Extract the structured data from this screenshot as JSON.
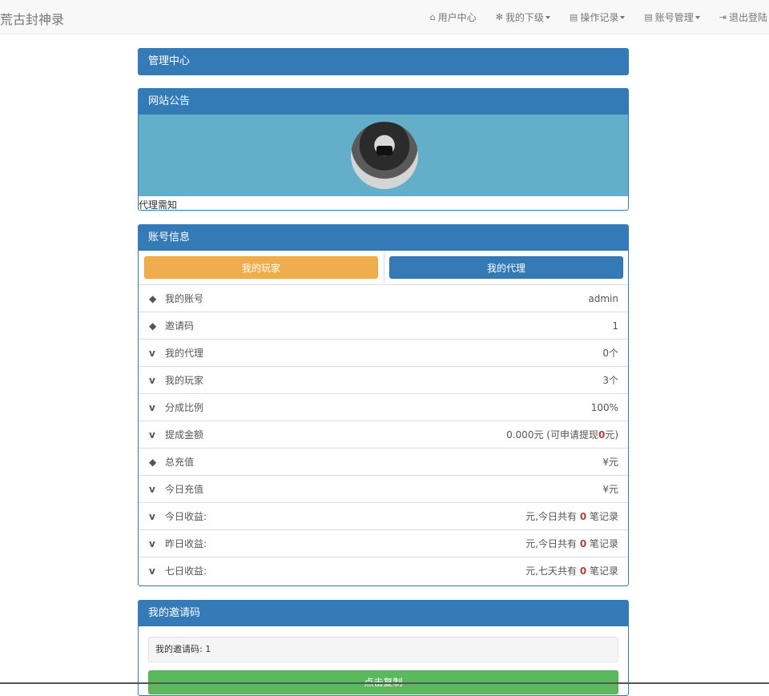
{
  "navbar": {
    "brand": "荒古封神录",
    "items": [
      {
        "icon": "home-icon",
        "glyph": "⌂",
        "label": "用户中心",
        "dropdown": false
      },
      {
        "icon": "gear-icon",
        "glyph": "✻",
        "label": "我的下级",
        "dropdown": true
      },
      {
        "icon": "id-card-icon",
        "glyph": "▤",
        "label": "操作记录",
        "dropdown": true
      },
      {
        "icon": "id-card-icon",
        "glyph": "▤",
        "label": "账号管理",
        "dropdown": true
      },
      {
        "icon": "logout-icon",
        "glyph": "⇥",
        "label": "退出登陆",
        "dropdown": false
      }
    ]
  },
  "admin_panel": {
    "title": "管理中心"
  },
  "notice_panel": {
    "title": "网站公告",
    "text": "代理需知"
  },
  "account_panel": {
    "title": "账号信息",
    "btn_players": "我的玩家",
    "btn_agents": "我的代理",
    "rows": [
      {
        "icon": "tags-icon",
        "glyph": "◆",
        "label": "我的账号",
        "value": "admin"
      },
      {
        "icon": "tags-icon",
        "glyph": "◆",
        "label": "邀请码",
        "value": "1"
      },
      {
        "icon": "vimeo-icon",
        "glyph": "v",
        "label": "我的代理",
        "value": "0个"
      },
      {
        "icon": "vimeo-icon",
        "glyph": "v",
        "label": "我的玩家",
        "value": "3个"
      },
      {
        "icon": "vimeo-icon",
        "glyph": "v",
        "label": "分成比例",
        "value": "100%"
      },
      {
        "icon": "vimeo-icon",
        "glyph": "v",
        "label": "提成金额",
        "value_prefix": "0.000元 (可申请提现",
        "value_red": "0",
        "value_suffix": "元)"
      },
      {
        "icon": "tags-icon",
        "glyph": "◆",
        "label": "总充值",
        "value": "¥元"
      },
      {
        "icon": "vimeo-icon",
        "glyph": "v",
        "label": "今日充值",
        "value": "¥元"
      },
      {
        "icon": "vimeo-icon",
        "glyph": "v",
        "label": "今日收益:",
        "value_prefix": "元,今日共有 ",
        "value_red": "0",
        "value_suffix": " 笔记录"
      },
      {
        "icon": "vimeo-icon",
        "glyph": "v",
        "label": "昨日收益:",
        "value_prefix": "元,今日共有 ",
        "value_red": "0",
        "value_suffix": " 笔记录"
      },
      {
        "icon": "vimeo-icon",
        "glyph": "v",
        "label": "七日收益:",
        "value_prefix": "元,七天共有 ",
        "value_red": "0",
        "value_suffix": " 笔记录"
      }
    ]
  },
  "invite_panel": {
    "title": "我的邀请码",
    "code_text": "我的邀请码: 1",
    "copy_button": "点击复制"
  }
}
